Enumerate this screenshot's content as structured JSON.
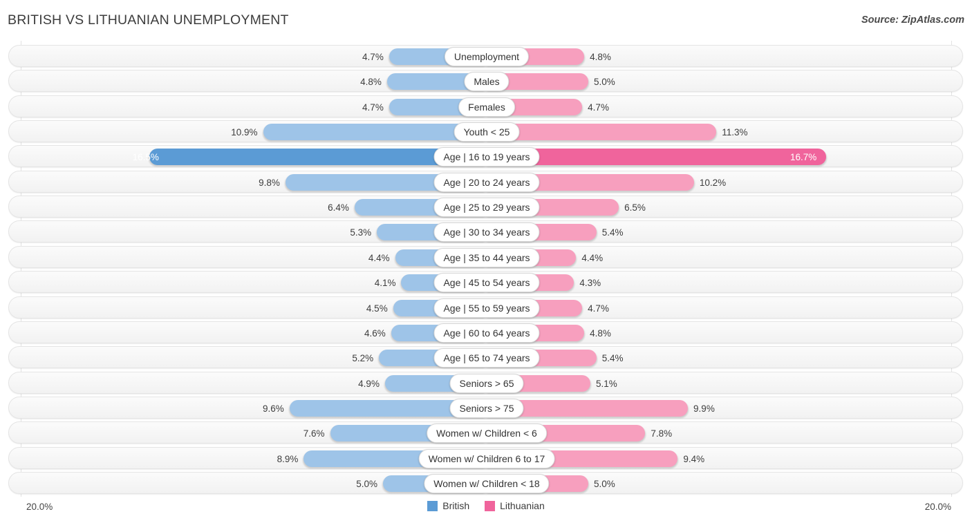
{
  "header": {
    "title": "BRITISH VS LITHUANIAN UNEMPLOYMENT",
    "source": "Source: ZipAtlas.com"
  },
  "footer": {
    "axis_min_label": "20.0%",
    "axis_max_label": "20.0%",
    "legend": [
      {
        "label": "British",
        "color": "#5B9BD5",
        "swatch_name": "legend-swatch-british"
      },
      {
        "label": "Lithuanian",
        "color": "#F0649C",
        "swatch_name": "legend-swatch-lithuanian"
      }
    ]
  },
  "colors": {
    "british_normal": "#9EC4E8",
    "british_highlight": "#5B9BD5",
    "lithuanian_normal": "#F79FBE",
    "lithuanian_highlight": "#F0649C",
    "track": "#f6f6f6",
    "gridline": "#e2e2e2"
  },
  "chart_data": {
    "type": "bar",
    "subtype": "diverging-bidirectional",
    "title": "BRITISH VS LITHUANIAN UNEMPLOYMENT",
    "xlabel": "",
    "ylabel": "",
    "unit": "%",
    "axis_max": 20.0,
    "axis_min_label": "20.0%",
    "axis_max_label": "20.0%",
    "grid": true,
    "legend_position": "bottom-center",
    "series": [
      {
        "name": "British",
        "color": "#9EC4E8",
        "direction": "left",
        "values": [
          4.7,
          4.8,
          4.7,
          10.9,
          16.5,
          9.8,
          6.4,
          5.3,
          4.4,
          4.1,
          4.5,
          4.6,
          5.2,
          4.9,
          9.6,
          7.6,
          8.9,
          5.0
        ]
      },
      {
        "name": "Lithuanian",
        "color": "#F79FBE",
        "direction": "right",
        "values": [
          4.8,
          5.0,
          4.7,
          11.3,
          16.7,
          10.2,
          6.5,
          5.4,
          4.4,
          4.3,
          4.7,
          4.8,
          5.4,
          5.1,
          9.9,
          7.8,
          9.4,
          5.0
        ]
      }
    ],
    "categories": [
      "Unemployment",
      "Males",
      "Females",
      "Youth < 25",
      "Age | 16 to 19 years",
      "Age | 20 to 24 years",
      "Age | 25 to 29 years",
      "Age | 30 to 34 years",
      "Age | 35 to 44 years",
      "Age | 45 to 54 years",
      "Age | 55 to 59 years",
      "Age | 60 to 64 years",
      "Age | 65 to 74 years",
      "Seniors > 65",
      "Seniors > 75",
      "Women w/ Children < 6",
      "Women w/ Children 6 to 17",
      "Women w/ Children < 18"
    ]
  },
  "rows": [
    {
      "label": "Unemployment",
      "left_value": 4.7,
      "left_text": "4.7%",
      "right_value": 4.8,
      "right_text": "4.8%",
      "highlight": false
    },
    {
      "label": "Males",
      "left_value": 4.8,
      "left_text": "4.8%",
      "right_value": 5.0,
      "right_text": "5.0%",
      "highlight": false
    },
    {
      "label": "Females",
      "left_value": 4.7,
      "left_text": "4.7%",
      "right_value": 4.7,
      "right_text": "4.7%",
      "highlight": false
    },
    {
      "label": "Youth < 25",
      "left_value": 10.9,
      "left_text": "10.9%",
      "right_value": 11.3,
      "right_text": "11.3%",
      "highlight": false
    },
    {
      "label": "Age | 16 to 19 years",
      "left_value": 16.5,
      "left_text": "16.5%",
      "right_value": 16.7,
      "right_text": "16.7%",
      "highlight": true
    },
    {
      "label": "Age | 20 to 24 years",
      "left_value": 9.8,
      "left_text": "9.8%",
      "right_value": 10.2,
      "right_text": "10.2%",
      "highlight": false
    },
    {
      "label": "Age | 25 to 29 years",
      "left_value": 6.4,
      "left_text": "6.4%",
      "right_value": 6.5,
      "right_text": "6.5%",
      "highlight": false
    },
    {
      "label": "Age | 30 to 34 years",
      "left_value": 5.3,
      "left_text": "5.3%",
      "right_value": 5.4,
      "right_text": "5.4%",
      "highlight": false
    },
    {
      "label": "Age | 35 to 44 years",
      "left_value": 4.4,
      "left_text": "4.4%",
      "right_value": 4.4,
      "right_text": "4.4%",
      "highlight": false
    },
    {
      "label": "Age | 45 to 54 years",
      "left_value": 4.1,
      "left_text": "4.1%",
      "right_value": 4.3,
      "right_text": "4.3%",
      "highlight": false
    },
    {
      "label": "Age | 55 to 59 years",
      "left_value": 4.5,
      "left_text": "4.5%",
      "right_value": 4.7,
      "right_text": "4.7%",
      "highlight": false
    },
    {
      "label": "Age | 60 to 64 years",
      "left_value": 4.6,
      "left_text": "4.6%",
      "right_value": 4.8,
      "right_text": "4.8%",
      "highlight": false
    },
    {
      "label": "Age | 65 to 74 years",
      "left_value": 5.2,
      "left_text": "5.2%",
      "right_value": 5.4,
      "right_text": "5.4%",
      "highlight": false
    },
    {
      "label": "Seniors > 65",
      "left_value": 4.9,
      "left_text": "4.9%",
      "right_value": 5.1,
      "right_text": "5.1%",
      "highlight": false
    },
    {
      "label": "Seniors > 75",
      "left_value": 9.6,
      "left_text": "9.6%",
      "right_value": 9.9,
      "right_text": "9.9%",
      "highlight": false
    },
    {
      "label": "Women w/ Children < 6",
      "left_value": 7.6,
      "left_text": "7.6%",
      "right_value": 7.8,
      "right_text": "7.8%",
      "highlight": false
    },
    {
      "label": "Women w/ Children 6 to 17",
      "left_value": 8.9,
      "left_text": "8.9%",
      "right_value": 9.4,
      "right_text": "9.4%",
      "highlight": false
    },
    {
      "label": "Women w/ Children < 18",
      "left_value": 5.0,
      "left_text": "5.0%",
      "right_value": 5.0,
      "right_text": "5.0%",
      "highlight": false
    }
  ]
}
